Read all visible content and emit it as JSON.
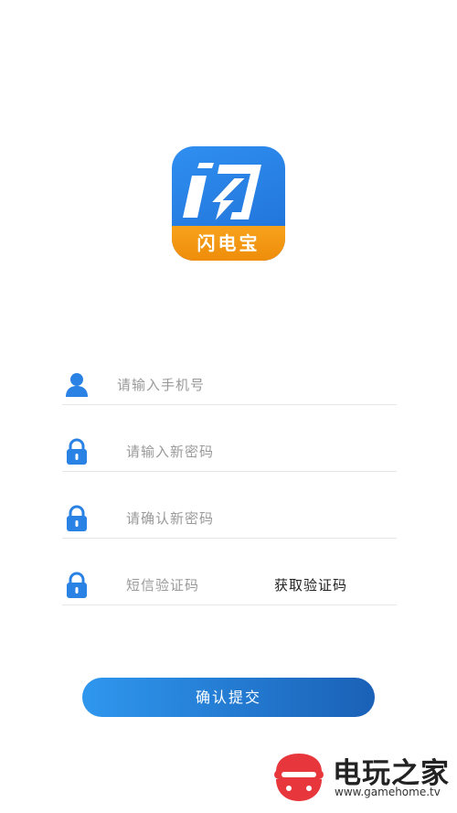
{
  "app": {
    "logo_label": "闪电宝",
    "brand_blue": "#2a82e4",
    "brand_orange": "#f39a13"
  },
  "form": {
    "phone": {
      "placeholder": "请输入手机号",
      "icon": "user-icon"
    },
    "new_password": {
      "placeholder": "请输入新密码",
      "icon": "lock-icon"
    },
    "confirm_password": {
      "placeholder": "请确认新密码",
      "icon": "lock-icon"
    },
    "sms_code": {
      "placeholder": "短信验证码",
      "icon": "lock-icon",
      "get_code_label": "获取验证码"
    }
  },
  "submit": {
    "label": "确认提交"
  },
  "watermark": {
    "title": "电玩之家",
    "url": "www.gamehome.tv"
  }
}
